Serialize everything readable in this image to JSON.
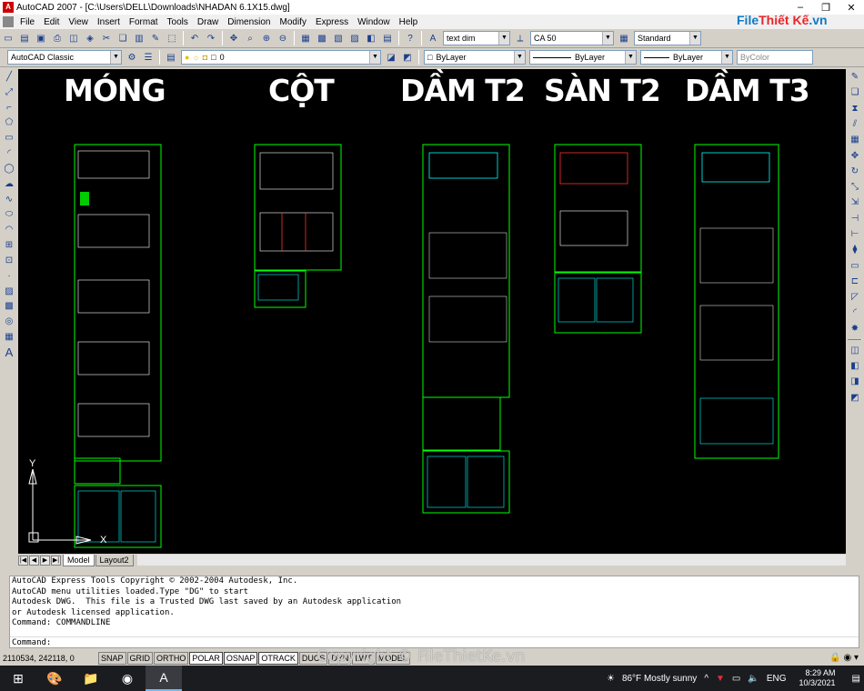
{
  "window": {
    "title": "AutoCAD 2007 - [C:\\Users\\DELL\\Downloads\\NHADAN 6.1X15.dwg]",
    "minimize": "–",
    "restore": "❐",
    "close": "✕"
  },
  "menu": [
    "File",
    "Edit",
    "View",
    "Insert",
    "Format",
    "Tools",
    "Draw",
    "Dimension",
    "Modify",
    "Express",
    "Window",
    "Help"
  ],
  "watermark": {
    "part1": "File",
    "part2": "Thiết Kế",
    "part3": ".vn"
  },
  "toolbar": {
    "text_style": "text dim",
    "dim_style": "CA 50",
    "table_style": "Standard",
    "workspace": "AutoCAD Classic",
    "layer": "0",
    "color": "ByLayer",
    "linetype": "ByLayer",
    "lineweight": "ByLayer",
    "plotstyle": "ByColor"
  },
  "drawing": {
    "labels": [
      "MÓNG",
      "CỘT",
      "DẦM T2",
      "SÀN T2",
      "DẦM T3"
    ],
    "ucs_y": "Y",
    "ucs_x": "X"
  },
  "layout_tabs": [
    "Model",
    "Layout2"
  ],
  "command": {
    "history": [
      "AutoCAD Express Tools Copyright © 2002-2004 Autodesk, Inc.",
      "AutoCAD menu utilities loaded.Type \"DG\" to start",
      "Autodesk DWG.  This file is a Trusted DWG last saved by an Autodesk application",
      "or Autodesk licensed application.",
      "Command: COMMANDLINE"
    ],
    "prompt": "Command:"
  },
  "status": {
    "coords": "2110534, 242118, 0",
    "buttons": [
      "SNAP",
      "GRID",
      "ORTHO",
      "POLAR",
      "OSNAP",
      "OTRACK",
      "DUCS",
      "DYN",
      "LWT",
      "MODEL"
    ],
    "copyright": "Copyright © FileThietKe.vn"
  },
  "taskbar": {
    "weather": "86°F  Mostly sunny",
    "lang": "ENG",
    "time": "8:29 AM",
    "date": "10/3/2021"
  }
}
